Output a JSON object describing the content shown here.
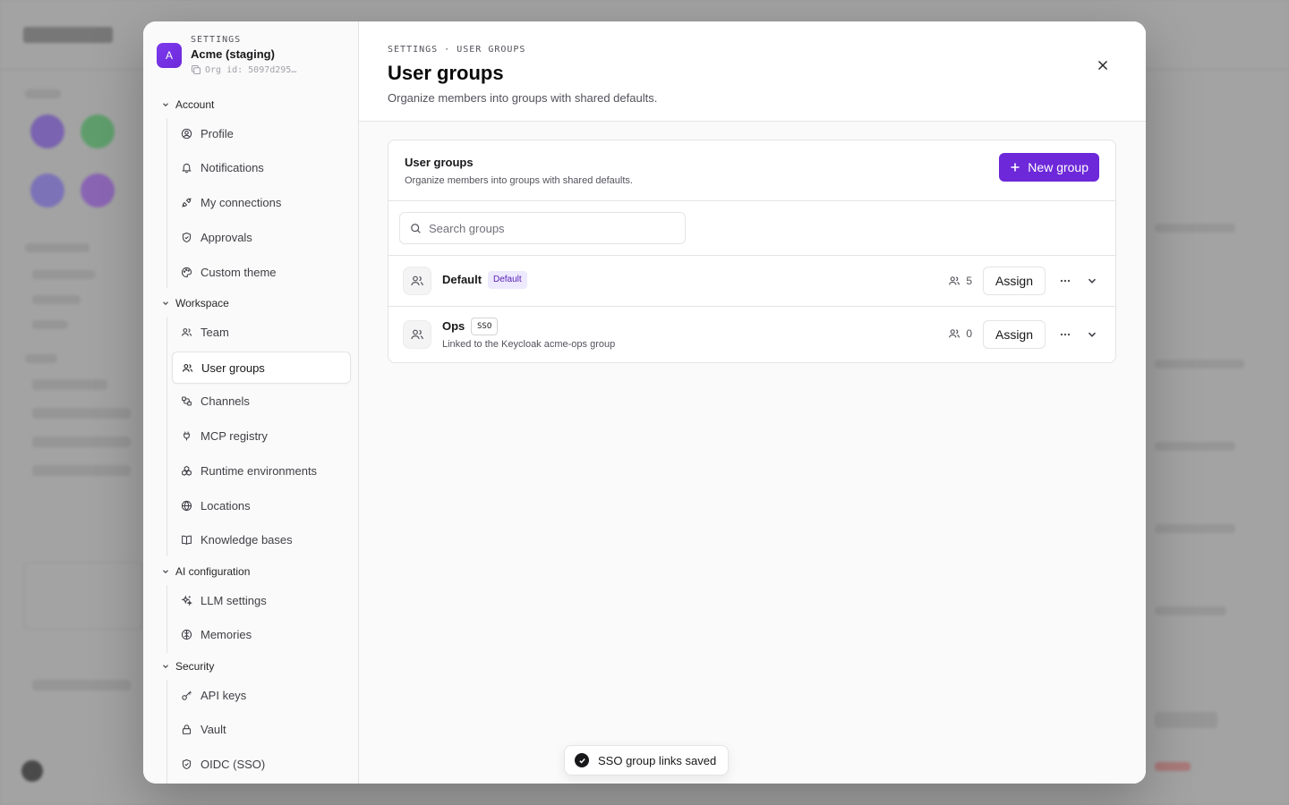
{
  "org": {
    "eyebrow": "SETTINGS",
    "avatar_letter": "A",
    "name": "Acme (staging)",
    "org_id": "Org id: 5097d295…"
  },
  "sidebar": {
    "sections": [
      {
        "label": "Account",
        "items": [
          {
            "label": "Profile",
            "icon": "user-circle-icon"
          },
          {
            "label": "Notifications",
            "icon": "bell-icon"
          },
          {
            "label": "My connections",
            "icon": "plug-icon"
          },
          {
            "label": "Approvals",
            "icon": "shield-check-icon"
          },
          {
            "label": "Custom theme",
            "icon": "palette-icon"
          }
        ]
      },
      {
        "label": "Workspace",
        "items": [
          {
            "label": "Team",
            "icon": "users-icon"
          },
          {
            "label": "User groups",
            "icon": "user-group-icon",
            "active": true
          },
          {
            "label": "Channels",
            "icon": "channels-icon"
          },
          {
            "label": "MCP registry",
            "icon": "plug-connector-icon"
          },
          {
            "label": "Runtime environments",
            "icon": "boxes-icon"
          },
          {
            "label": "Locations",
            "icon": "globe-icon"
          },
          {
            "label": "Knowledge bases",
            "icon": "book-icon"
          }
        ]
      },
      {
        "label": "AI configuration",
        "items": [
          {
            "label": "LLM settings",
            "icon": "sparkles-icon"
          },
          {
            "label": "Memories",
            "icon": "brain-icon"
          }
        ]
      },
      {
        "label": "Security",
        "items": [
          {
            "label": "API keys",
            "icon": "key-icon"
          },
          {
            "label": "Vault",
            "icon": "lock-icon"
          },
          {
            "label": "OIDC (SSO)",
            "icon": "shield-check-icon"
          }
        ]
      }
    ]
  },
  "header": {
    "eyebrow": "SETTINGS · USER GROUPS",
    "title": "User groups",
    "subtitle": "Organize members into groups with shared defaults."
  },
  "card": {
    "title": "User groups",
    "subtitle": "Organize members into groups with shared defaults.",
    "new_button": "New group",
    "search_placeholder": "Search groups"
  },
  "groups": [
    {
      "name": "Default",
      "badge": "Default",
      "badge_style": "default",
      "description": "",
      "members": "5",
      "assign_label": "Assign"
    },
    {
      "name": "Ops",
      "badge": "SSO",
      "badge_style": "sso",
      "description": "Linked to the Keycloak acme-ops group",
      "members": "0",
      "assign_label": "Assign"
    }
  ],
  "toast": {
    "message": "SSO group links saved"
  },
  "colors": {
    "accent": "#6d28d9",
    "badge_bg": "#ede9fe",
    "badge_text": "#5b21b6"
  }
}
